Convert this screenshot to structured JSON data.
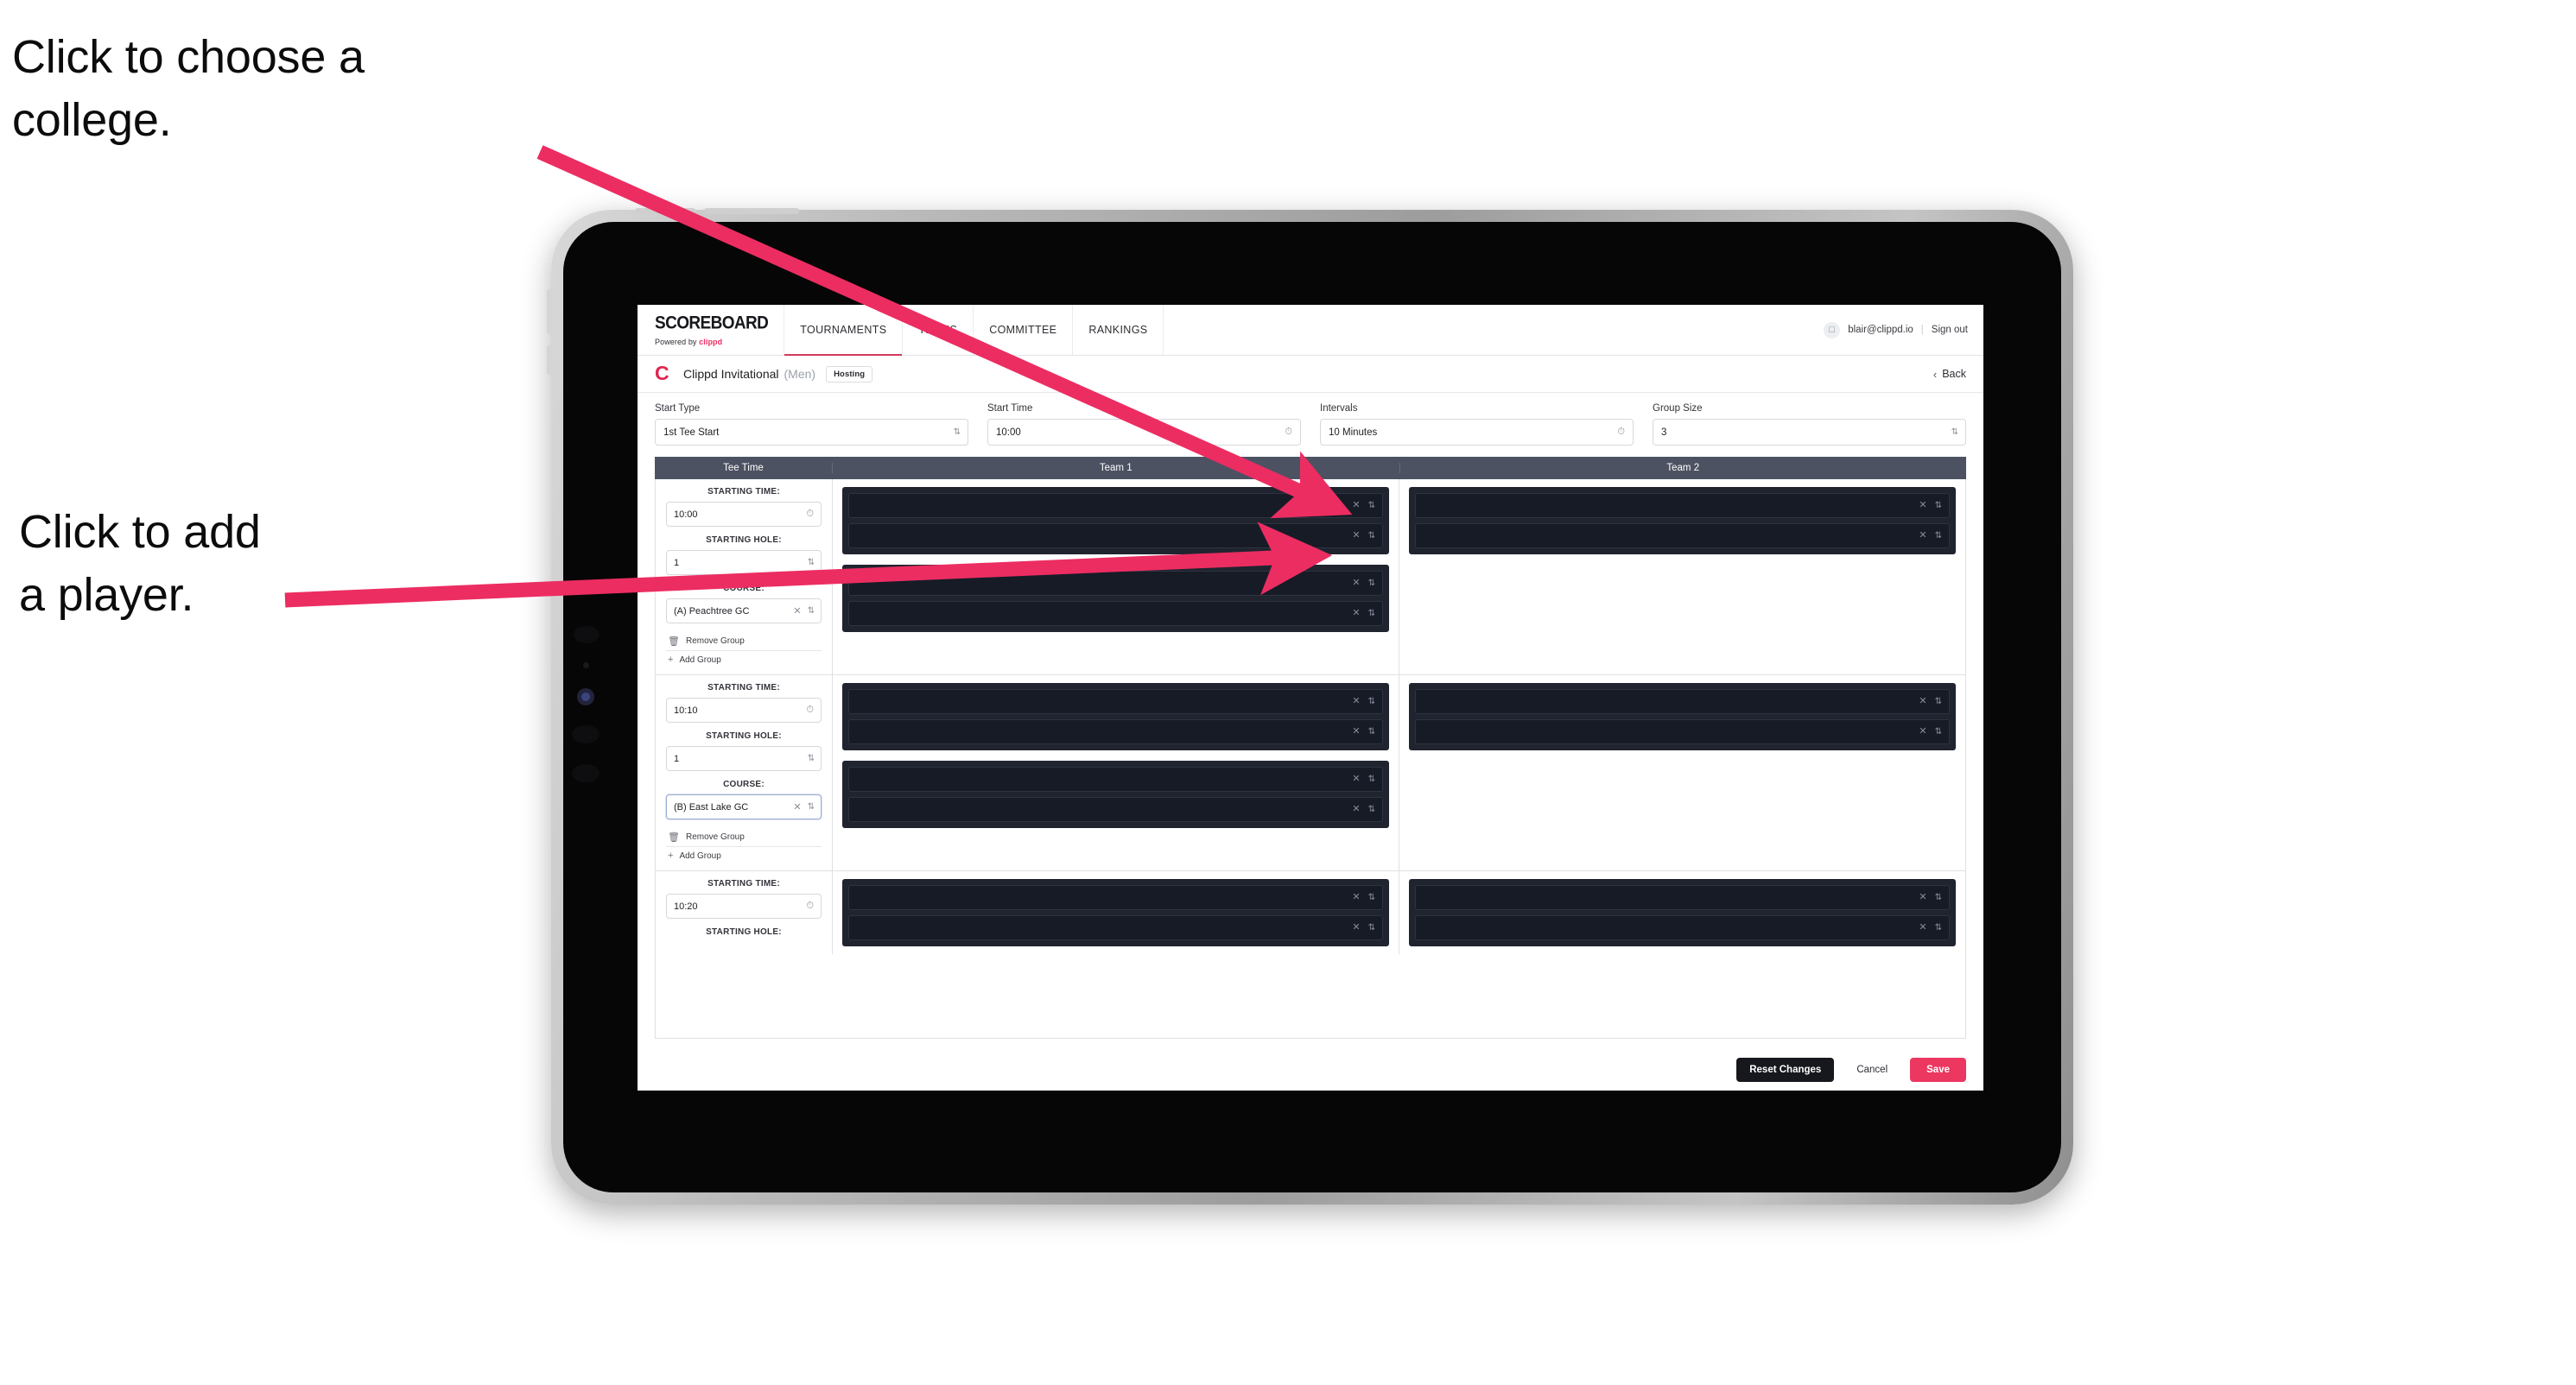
{
  "annotations": [
    {
      "id": "choose-college",
      "text": "Click to choose a\ncollege."
    },
    {
      "id": "add-player",
      "text": "Click to add\na player."
    }
  ],
  "colors": {
    "accent_pink": "#ec2d62",
    "arrow_pink": "#ec2d62",
    "table_header": "#4c5262",
    "player_row_bg": "#171b26",
    "group_bg": "#20242f",
    "save_button": "#ec3761",
    "reset_button": "#17181d"
  },
  "topnav": {
    "brand_title": "SCOREBOARD",
    "brand_sub_prefix": "Powered by ",
    "brand_sub_mark": "clippd",
    "tabs": [
      {
        "label": "TOURNAMENTS",
        "active": true
      },
      {
        "label": "TEAMS",
        "active": false
      },
      {
        "label": "COMMITTEE",
        "active": false
      },
      {
        "label": "RANKINGS",
        "active": false
      }
    ],
    "avatar_icon": "user-avatar-icon",
    "user_email": "blair@clippd.io",
    "separator": "|",
    "sign_out": "Sign out"
  },
  "tournament_bar": {
    "logo_letter": "C",
    "name": "Clippd Invitational",
    "gender": "(Men)",
    "badge": "Hosting",
    "back_chevron": "‹",
    "back_label": "Back"
  },
  "settings": [
    {
      "label": "Start Type",
      "value": "1st Tee Start",
      "icon": "stepper-icon"
    },
    {
      "label": "Start Time",
      "value": "10:00",
      "icon": "clock-icon"
    },
    {
      "label": "Intervals",
      "value": "10 Minutes",
      "icon": "clock-icon"
    },
    {
      "label": "Group Size",
      "value": "3",
      "icon": "stepper-icon"
    }
  ],
  "table": {
    "columns": [
      "Tee Time",
      "Team 1",
      "Team 2"
    ],
    "labels": {
      "starting_time": "STARTING TIME:",
      "starting_hole": "STARTING HOLE:",
      "course": "COURSE:",
      "remove_group": "Remove Group",
      "add_group": "Add Group",
      "trash_icon": "trash-icon",
      "plus_icon": "plus-icon",
      "clock_icon": "clock-icon",
      "stepper_icon": "stepper-icon",
      "clear_icon": "clear-x-icon"
    },
    "rows": [
      {
        "starting_time": "10:00",
        "starting_hole": "1",
        "course": "(A) Peachtree GC",
        "course_focused": false,
        "team1_groups": [
          {
            "players": [
              "",
              ""
            ]
          },
          {
            "players": [
              "",
              ""
            ]
          }
        ],
        "team2_groups": [
          {
            "players": [
              "",
              ""
            ]
          }
        ]
      },
      {
        "starting_time": "10:10",
        "starting_hole": "1",
        "course": "(B) East Lake GC",
        "course_focused": true,
        "team1_groups": [
          {
            "players": [
              "",
              ""
            ]
          },
          {
            "players": [
              "",
              ""
            ]
          }
        ],
        "team2_groups": [
          {
            "players": [
              "",
              ""
            ]
          }
        ]
      },
      {
        "starting_time": "10:20",
        "starting_hole": "",
        "course": "",
        "course_focused": false,
        "partial": true,
        "team1_groups": [
          {
            "players": [
              "",
              ""
            ]
          }
        ],
        "team2_groups": [
          {
            "players": [
              "",
              ""
            ]
          }
        ]
      }
    ]
  },
  "footer": {
    "reset_label": "Reset Changes",
    "cancel_label": "Cancel",
    "save_label": "Save"
  }
}
